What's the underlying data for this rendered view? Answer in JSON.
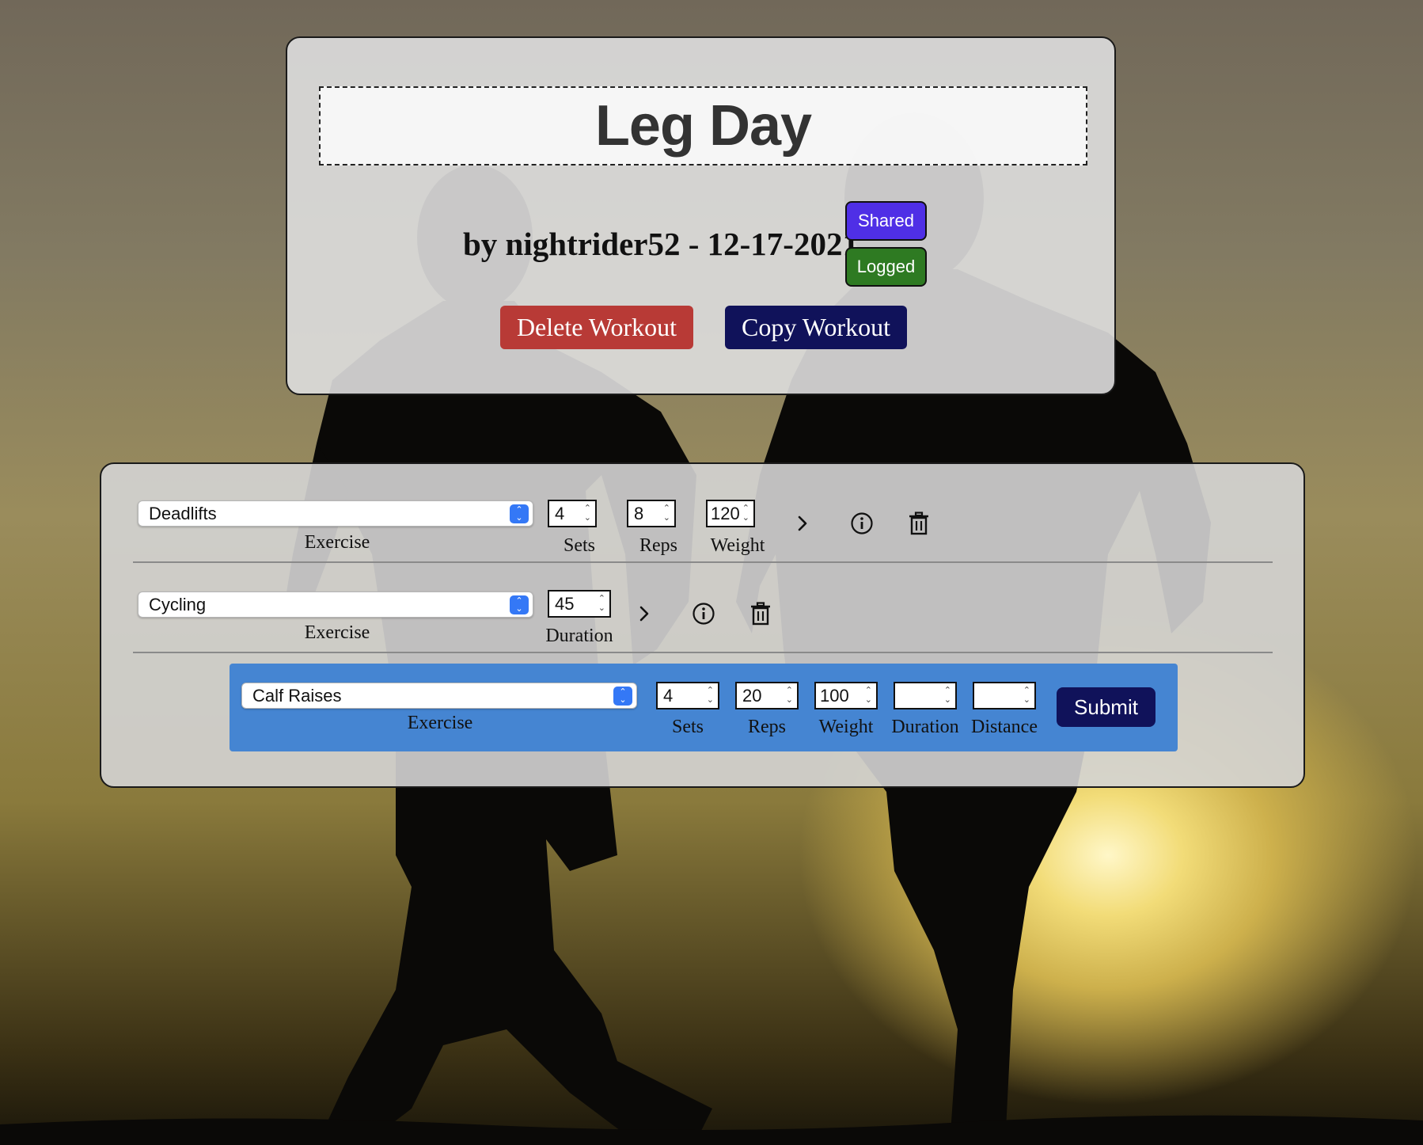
{
  "workout": {
    "title": "Leg Day",
    "byline": "by nightrider52 - 12-17-2021",
    "badges": {
      "shared": "Shared",
      "logged": "Logged"
    },
    "actions": {
      "delete": "Delete Workout",
      "copy": "Copy Workout"
    }
  },
  "exercises": [
    {
      "name": "Deadlifts",
      "fields": [
        {
          "label": "Sets",
          "value": "4"
        },
        {
          "label": "Reps",
          "value": "8"
        },
        {
          "label": "Weight",
          "value": "120"
        }
      ]
    },
    {
      "name": "Cycling",
      "fields": [
        {
          "label": "Duration",
          "value": "45"
        }
      ]
    }
  ],
  "labels": {
    "exercise": "Exercise"
  },
  "new_exercise": {
    "selected": "Calf Raises",
    "fields": [
      {
        "label": "Sets",
        "value": "4"
      },
      {
        "label": "Reps",
        "value": "20"
      },
      {
        "label": "Weight",
        "value": "100"
      },
      {
        "label": "Duration",
        "value": ""
      },
      {
        "label": "Distance",
        "value": ""
      }
    ],
    "submit": "Submit"
  },
  "colors": {
    "shared_badge": "#4f2fe6",
    "logged_badge": "#2e7a22",
    "delete_button": "#b83a36",
    "copy_button": "#10125a",
    "new_exercise_panel": "#4585d2",
    "select_arrow": "#3478f6"
  },
  "icons": {
    "row_actions": [
      "chevron-right-icon",
      "info-icon",
      "trash-icon"
    ],
    "select": "select-arrows-icon",
    "number": "stepper-arrows-icon",
    "background": "runners-silhouette"
  }
}
